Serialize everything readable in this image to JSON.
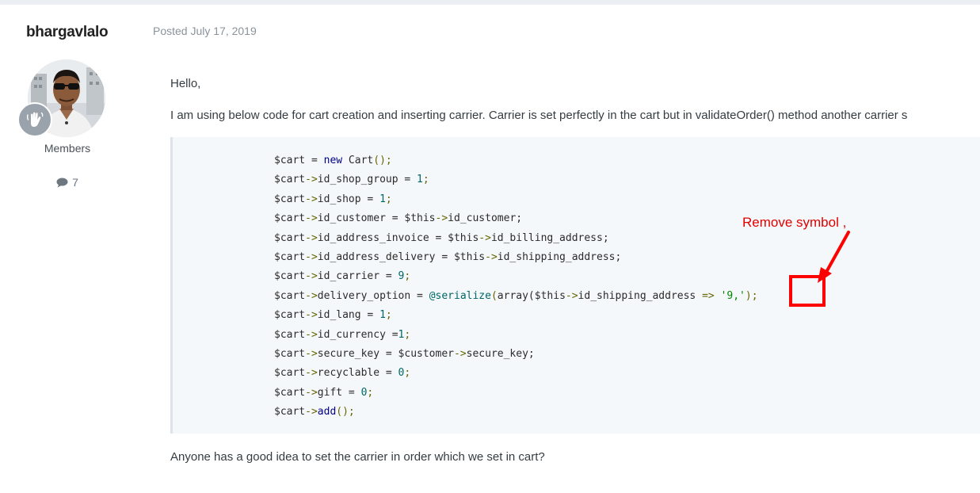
{
  "author": {
    "name": "bhargavlalo",
    "group": "Members",
    "post_count": "7"
  },
  "post": {
    "posted": "Posted July 17, 2019",
    "greeting": "Hello,",
    "intro": "I am using below code for cart creation and inserting carrier.   Carrier is set perfectly in the cart but in validateOrder() method another carrier s",
    "closing": "Anyone has a good idea to set the carrier in order which we set in cart?"
  },
  "code": {
    "lines": [
      [
        {
          "t": "$cart = ",
          "c": ""
        },
        {
          "t": "new",
          "c": "kw"
        },
        {
          "t": " Cart",
          "c": ""
        },
        {
          "t": "();",
          "c": "op"
        }
      ],
      [
        {
          "t": "$cart",
          "c": ""
        },
        {
          "t": "->",
          "c": "op"
        },
        {
          "t": "id_shop_group = ",
          "c": ""
        },
        {
          "t": "1",
          "c": "num"
        },
        {
          "t": ";",
          "c": "op"
        }
      ],
      [
        {
          "t": "$cart",
          "c": ""
        },
        {
          "t": "->",
          "c": "op"
        },
        {
          "t": "id_shop = ",
          "c": ""
        },
        {
          "t": "1",
          "c": "num"
        },
        {
          "t": ";",
          "c": "op"
        }
      ],
      [
        {
          "t": "$cart",
          "c": ""
        },
        {
          "t": "->",
          "c": "op"
        },
        {
          "t": "id_customer = $this",
          "c": ""
        },
        {
          "t": "->",
          "c": "op"
        },
        {
          "t": "id_customer;",
          "c": ""
        }
      ],
      [
        {
          "t": "$cart",
          "c": ""
        },
        {
          "t": "->",
          "c": "op"
        },
        {
          "t": "id_address_invoice = $this",
          "c": ""
        },
        {
          "t": "->",
          "c": "op"
        },
        {
          "t": "id_billing_address;",
          "c": ""
        }
      ],
      [
        {
          "t": "$cart",
          "c": ""
        },
        {
          "t": "->",
          "c": "op"
        },
        {
          "t": "id_address_delivery = $this",
          "c": ""
        },
        {
          "t": "->",
          "c": "op"
        },
        {
          "t": "id_shipping_address;",
          "c": ""
        }
      ],
      [
        {
          "t": "$cart",
          "c": ""
        },
        {
          "t": "->",
          "c": "op"
        },
        {
          "t": "id_carrier = ",
          "c": ""
        },
        {
          "t": "9",
          "c": "num"
        },
        {
          "t": ";",
          "c": "op"
        }
      ],
      [
        {
          "t": "$cart",
          "c": ""
        },
        {
          "t": "->",
          "c": "op"
        },
        {
          "t": "delivery_option = ",
          "c": ""
        },
        {
          "t": "@serialize",
          "c": "ann"
        },
        {
          "t": "(",
          "c": "op"
        },
        {
          "t": "array($this",
          "c": ""
        },
        {
          "t": "->",
          "c": "op"
        },
        {
          "t": "id_shipping_address ",
          "c": ""
        },
        {
          "t": "=>",
          "c": "op"
        },
        {
          "t": " ",
          "c": ""
        },
        {
          "t": "'9,'",
          "c": "str"
        },
        {
          "t": ");",
          "c": "op"
        }
      ],
      [
        {
          "t": "$cart",
          "c": ""
        },
        {
          "t": "->",
          "c": "op"
        },
        {
          "t": "id_lang = ",
          "c": ""
        },
        {
          "t": "1",
          "c": "num"
        },
        {
          "t": ";",
          "c": "op"
        }
      ],
      [
        {
          "t": "$cart",
          "c": ""
        },
        {
          "t": "->",
          "c": "op"
        },
        {
          "t": "id_currency =",
          "c": ""
        },
        {
          "t": "1",
          "c": "num"
        },
        {
          "t": ";",
          "c": "op"
        }
      ],
      [
        {
          "t": "$cart",
          "c": ""
        },
        {
          "t": "->",
          "c": "op"
        },
        {
          "t": "secure_key = $customer",
          "c": ""
        },
        {
          "t": "->",
          "c": "op"
        },
        {
          "t": "secure_key;",
          "c": ""
        }
      ],
      [
        {
          "t": "$cart",
          "c": ""
        },
        {
          "t": "->",
          "c": "op"
        },
        {
          "t": "recyclable = ",
          "c": ""
        },
        {
          "t": "0",
          "c": "num"
        },
        {
          "t": ";",
          "c": "op"
        }
      ],
      [
        {
          "t": "$cart",
          "c": ""
        },
        {
          "t": "->",
          "c": "op"
        },
        {
          "t": "gift = ",
          "c": ""
        },
        {
          "t": "0",
          "c": "num"
        },
        {
          "t": ";",
          "c": "op"
        }
      ],
      [
        {
          "t": "$cart",
          "c": ""
        },
        {
          "t": "->",
          "c": "op"
        },
        {
          "t": "add",
          "c": "kw"
        },
        {
          "t": "();",
          "c": "op"
        }
      ]
    ]
  },
  "annotation": {
    "label": "Remove symbol ,",
    "color": "#ff0000"
  },
  "icons": {
    "rank": "hand-wave-icon",
    "posts": "comment-icon"
  }
}
